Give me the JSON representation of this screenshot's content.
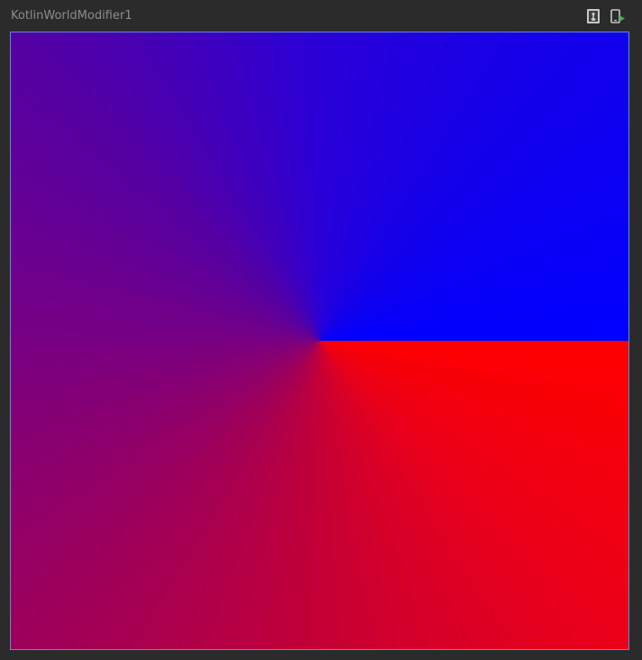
{
  "window": {
    "title": "KotlinWorldModifier1"
  },
  "toolbar": {
    "buttons": [
      {
        "icon": "interactive-mode-icon",
        "tooltip": ""
      },
      {
        "icon": "deploy-preview-icon",
        "tooltip": ""
      }
    ]
  },
  "preview": {
    "content": "sweep-gradient-canvas",
    "colors": {
      "start": "#ff0000",
      "end": "#0000ff",
      "frame_border": "#5e8cc9",
      "background": "#2b2b2b",
      "deploy_accent": "#4caf50"
    }
  }
}
